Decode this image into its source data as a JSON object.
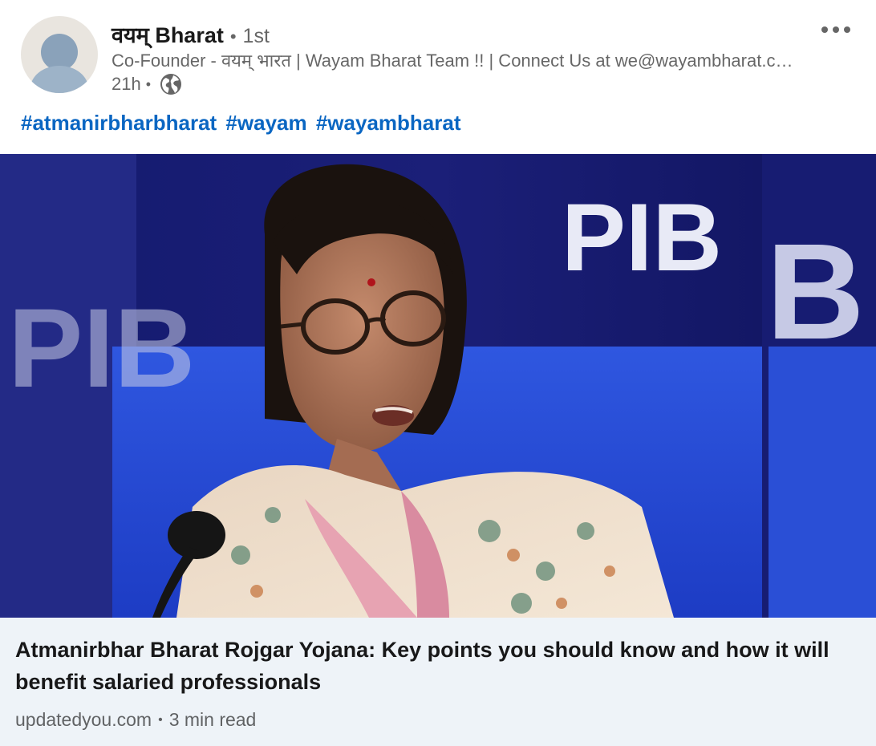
{
  "post": {
    "actor": {
      "name": "वयम् Bharat",
      "separator": "•",
      "degree": "1st",
      "headline": "Co-Founder - वयम् भारत | Wayam Bharat Team !! | Connect Us at we@wayambharat.com",
      "time": "21h",
      "time_separator": "•",
      "visibility_icon": "globe-icon"
    },
    "menu_icon": "ellipsis-icon",
    "hashtags": [
      "#atmanirbharbharat",
      "#wayam",
      "#wayambharat"
    ],
    "image": {
      "banner_text_main": "PIB",
      "banner_text_left": "PIB",
      "banner_text_right": "B"
    },
    "article": {
      "title": "Atmanirbhar Bharat Rojgar Yojana: Key points you should know and how it will benefit salaried professionals",
      "source": "updatedyou.com",
      "separator": "•",
      "read_time": "3 min read"
    }
  },
  "colors": {
    "link_blue": "#0a66c2",
    "card_background": "#eef3f8",
    "secondary_text": "#666666",
    "banner_blue": "#1b1f78"
  }
}
